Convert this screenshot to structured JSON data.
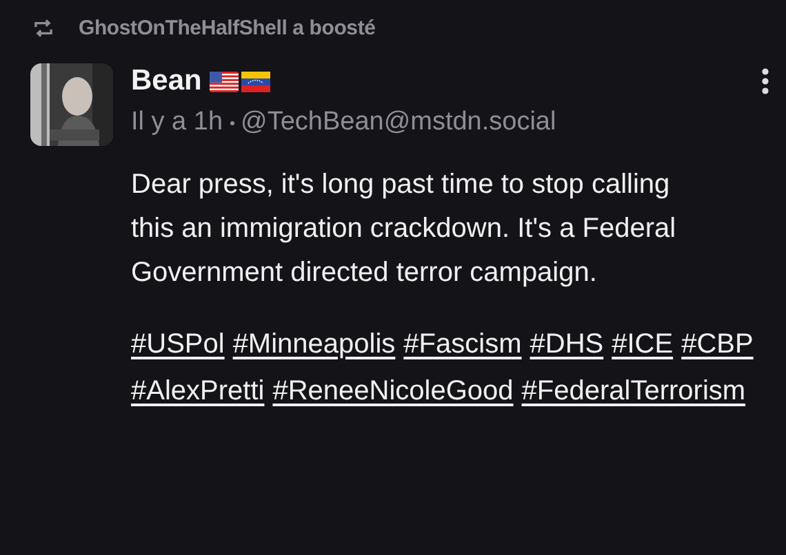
{
  "boost": {
    "text": "GhostOnTheHalfShell a boosté"
  },
  "post": {
    "author": "Bean",
    "time": "Il y a 1h",
    "handle": "@TechBean@mstdn.social",
    "body": "Dear press, it's long past time to stop calling this an immigration crackdown. It's a Federal Government directed terror campaign.",
    "hashtags": [
      "#USPol",
      "#Minneapolis",
      "#Fascism",
      "#DHS",
      "#ICE",
      "#CBP",
      "#AlexPretti",
      "#ReneeNicoleGood",
      "#FederalTerrorism"
    ]
  }
}
